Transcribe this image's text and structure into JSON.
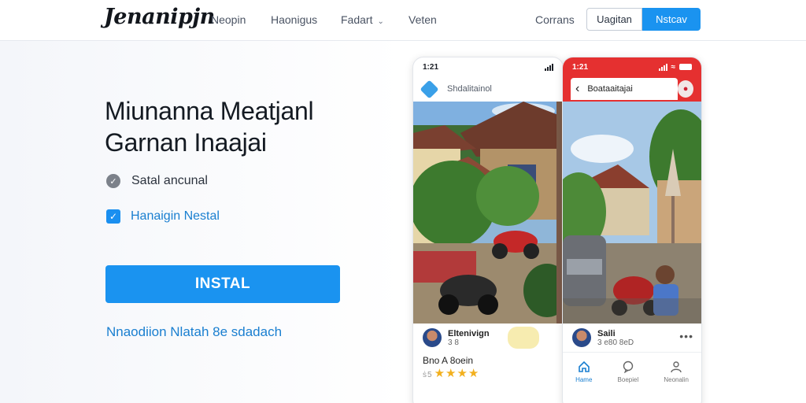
{
  "header": {
    "logo": "Jenanipjn",
    "nav": [
      "Neopin",
      "Haonigus",
      "Fadart",
      "Veten",
      "Corrans"
    ],
    "login_label": "Uagitan",
    "signup_label": "Nstcav"
  },
  "hero": {
    "title": "Miunanna Meatjanl Garnan Inaajai",
    "features": [
      "Satal ancunal",
      "Hanaigin Nestal"
    ],
    "install_label": "INSTAL",
    "sub_link": "Nnaodiion Nlatah 8e sdadach"
  },
  "phone1": {
    "time": "1:21",
    "header_text": "Shdalitainol",
    "post_name": "Eltenivign",
    "post_sub": "3 8",
    "rating_title": "Bno A 8oein",
    "stars": "★★★★",
    "stars_lead": "ṡ5"
  },
  "phone2": {
    "time": "1:21",
    "header_text": "Boataaitajai",
    "post_name": "Saili",
    "post_sub": "3 e80 8eD",
    "dots": "•••",
    "tabs": [
      "Hame",
      "Boepiel",
      "Neonalin"
    ]
  },
  "colors": {
    "accent": "#1a93f0",
    "phone2_header": "#e53030",
    "star": "#f2b01e"
  },
  "icons": [
    "check-circle-icon",
    "checkbox-icon",
    "chevron-down-icon",
    "back-arrow-icon",
    "home-icon",
    "chat-icon",
    "user-icon",
    "signal-icon",
    "wifi-icon",
    "battery-icon"
  ]
}
